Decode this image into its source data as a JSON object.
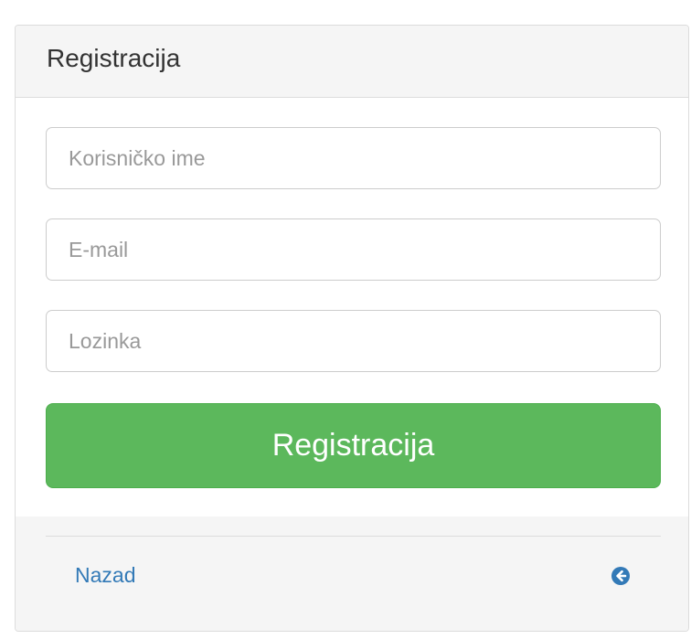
{
  "panel": {
    "title": "Registracija"
  },
  "form": {
    "username_placeholder": "Korisničko ime",
    "email_placeholder": "E-mail",
    "password_placeholder": "Lozinka",
    "submit_label": "Registracija"
  },
  "footer": {
    "back_label": "Nazad",
    "back_icon": "circle-arrow-left-icon"
  },
  "colors": {
    "primary_button": "#5cb85c",
    "link": "#337ab7",
    "heading_bg": "#f5f5f5"
  }
}
